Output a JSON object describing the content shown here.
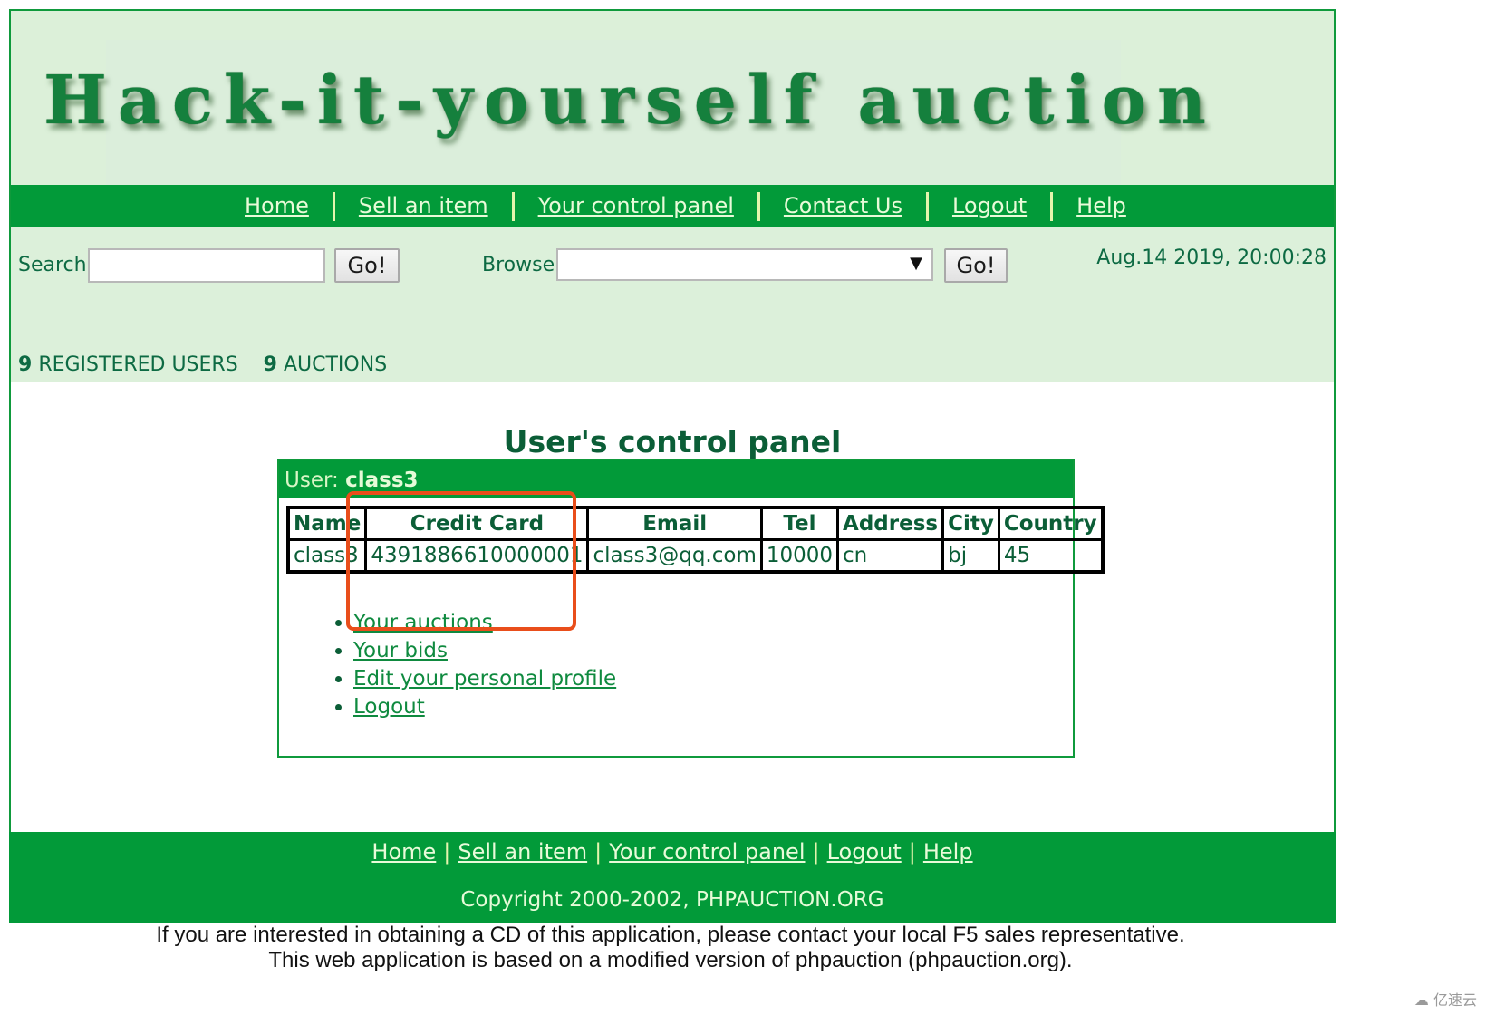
{
  "site": {
    "logo_text": "Hack-it-yourself auction"
  },
  "top_nav": {
    "items": [
      {
        "label": "Home"
      },
      {
        "label": "Sell an item"
      },
      {
        "label": "Your control panel"
      },
      {
        "label": "Contact Us"
      },
      {
        "label": "Logout"
      },
      {
        "label": "Help"
      }
    ]
  },
  "toolbar": {
    "search_label": "Search",
    "search_value": "",
    "search_go": "Go!",
    "browse_label": "Browse",
    "browse_selected": "",
    "browse_go": "Go!",
    "datetime": "Aug.14 2019, 20:00:28"
  },
  "stats": {
    "users_count": "9",
    "users_label": "REGISTERED USERS",
    "auctions_count": "9",
    "auctions_label": "AUCTIONS"
  },
  "main": {
    "title": "User's control panel",
    "user_prefix": "User:",
    "username": "class3",
    "table": {
      "headers": [
        "Name",
        "Credit Card",
        "Email",
        "Tel",
        "Address",
        "City",
        "Country"
      ],
      "rows": [
        [
          "class3",
          "4391886610000001",
          "class3@qq.com",
          "10000",
          "cn",
          "bj",
          "45"
        ]
      ]
    },
    "links": [
      {
        "label": "Your auctions"
      },
      {
        "label": "Your bids"
      },
      {
        "label": "Edit your personal profile"
      },
      {
        "label": "Logout"
      }
    ],
    "highlight_color": "#e94e1b"
  },
  "footer": {
    "nav": [
      {
        "label": "Home"
      },
      {
        "label": "Sell an item"
      },
      {
        "label": "Your control panel"
      },
      {
        "label": "Logout"
      },
      {
        "label": "Help"
      }
    ],
    "separator": "|",
    "copyright": "Copyright 2000-2002, PHPAUCTION.ORG",
    "notice_line1": "If you are interested in obtaining a CD of this application, please contact your local F5 sales representative.",
    "notice_line2": "This web application is based on a modified version of phpauction (phpauction.org)."
  },
  "watermark": "亿速云",
  "colors": {
    "brand_green": "#029a39",
    "banner_bg": "#dcf0d9",
    "text_green": "#0b5e37"
  }
}
